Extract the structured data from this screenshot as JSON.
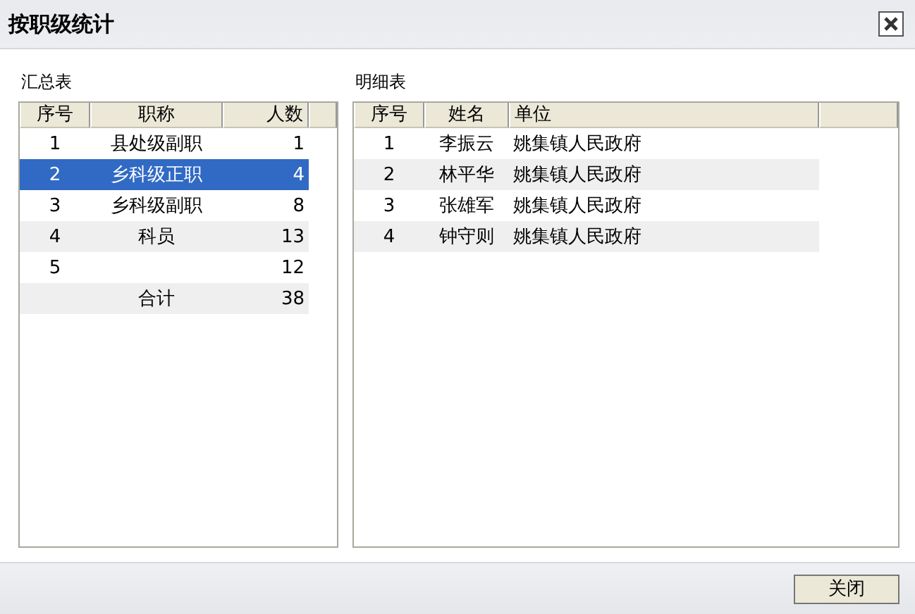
{
  "window": {
    "title": "按职级统计"
  },
  "summary": {
    "label": "汇总表",
    "columns": [
      "序号",
      "职称",
      "人数"
    ],
    "rows": [
      {
        "no": "1",
        "title": "县处级副职",
        "count": "1",
        "selected": false
      },
      {
        "no": "2",
        "title": "乡科级正职",
        "count": "4",
        "selected": true
      },
      {
        "no": "3",
        "title": "乡科级副职",
        "count": "8",
        "selected": false
      },
      {
        "no": "4",
        "title": "科员",
        "count": "13",
        "selected": false
      },
      {
        "no": "5",
        "count": "12",
        "selected": false
      },
      {
        "title": "合计",
        "count": "38",
        "selected": false
      }
    ]
  },
  "detail": {
    "label": "明细表",
    "columns": [
      "序号",
      "姓名",
      "单位"
    ],
    "rows": [
      {
        "no": "1",
        "name": "李振云",
        "unit": "姚集镇人民政府"
      },
      {
        "no": "2",
        "name": "林平华",
        "unit": "姚集镇人民政府"
      },
      {
        "no": "3",
        "name": "张雄军",
        "unit": "姚集镇人民政府"
      },
      {
        "no": "4",
        "name": "钟守则",
        "unit": "姚集镇人民政府"
      }
    ]
  },
  "buttons": [
    "关闭"
  ]
}
